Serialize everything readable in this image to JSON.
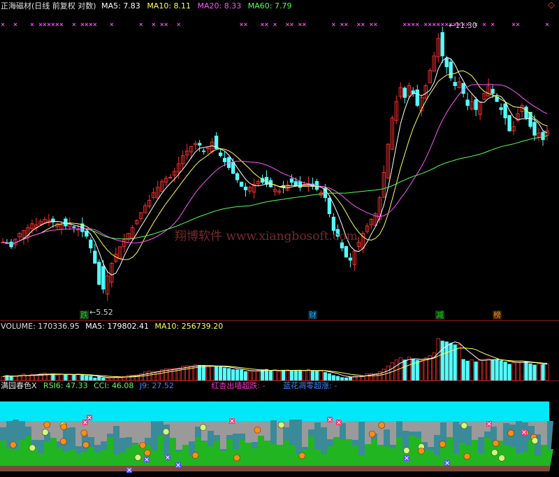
{
  "header": {
    "title": "正海磁材(日线 前复权 对数)",
    "ma5_label": "MA5:",
    "ma5_value": "7.83",
    "ma10_label": "MA10:",
    "ma10_value": "8.11",
    "ma20_label": "MA20:",
    "ma20_value": "8.33",
    "ma60_label": "MA60:",
    "ma60_value": "7.79",
    "corner_icon": "diamond-icon"
  },
  "main_chart": {
    "high_label": "11.30",
    "low_label": "5.52",
    "signals": [
      {
        "text": "跌",
        "color": "#00c000"
      },
      {
        "text": "财",
        "color": "#00c0ff"
      },
      {
        "text": "减",
        "color": "#00c000"
      },
      {
        "text": "榜",
        "color": "#ff9900"
      }
    ],
    "watermark": "翔博软件  www.xiangbosoft.com",
    "colors": {
      "up": "#ff3030",
      "down": "#54ffff",
      "ma5": "#ffffff",
      "ma10": "#ffff55",
      "ma20": "#ff55ff",
      "ma60": "#55ff55",
      "marker": "#ff44ff"
    }
  },
  "volume": {
    "label": "VOLUME:",
    "value": "170336.95",
    "ma5_label": "MA5:",
    "ma5_value": "179802.41",
    "ma10_label": "MA10:",
    "ma10_value": "256739.20"
  },
  "indicator": {
    "name": "满园春色X",
    "rsi_label": "RSI6:",
    "rsi_value": "47.33",
    "cci_label": "CCI:",
    "cci_value": "46.08",
    "j_label": "J9:",
    "j_value": "27.52",
    "red_label": "红杏出墙超跌:",
    "red_value": "-",
    "blue_label": "蓝花凋零超涨:",
    "blue_value": "-",
    "colors": {
      "sky": "#00e8f8",
      "ground": "#9a9a9a",
      "grass": "#22b522",
      "soil": "#7a4a3a"
    }
  },
  "chart_data": {
    "type": "candlestick",
    "price_scale": "log",
    "series_names": [
      "MA5",
      "MA10",
      "MA20",
      "MA60"
    ],
    "ylim": [
      5.2,
      11.6
    ],
    "closes": [
      6.3,
      6.28,
      6.22,
      6.35,
      6.45,
      6.5,
      6.55,
      6.62,
      6.6,
      6.66,
      6.7,
      6.68,
      6.65,
      6.62,
      6.6,
      6.58,
      6.62,
      6.56,
      6.52,
      6.48,
      6.4,
      6.2,
      5.95,
      5.62,
      5.55,
      5.75,
      5.95,
      6.1,
      6.22,
      6.34,
      6.45,
      6.55,
      6.68,
      6.82,
      6.95,
      7.05,
      7.2,
      7.3,
      7.42,
      7.48,
      7.5,
      7.62,
      7.78,
      7.95,
      8.05,
      8.15,
      8.22,
      8.18,
      8.05,
      8.12,
      8.25,
      8.1,
      7.95,
      7.82,
      7.7,
      7.58,
      7.45,
      7.32,
      7.25,
      7.3,
      7.36,
      7.42,
      7.4,
      7.36,
      7.31,
      7.26,
      7.23,
      7.3,
      7.35,
      7.4,
      7.33,
      7.3,
      7.36,
      7.38,
      7.32,
      7.26,
      7.2,
      7.1,
      6.8,
      6.5,
      6.4,
      6.2,
      6.05,
      6.0,
      6.15,
      6.3,
      6.45,
      6.58,
      6.7,
      6.8,
      7.1,
      7.6,
      8.2,
      8.8,
      9.2,
      9.55,
      9.3,
      9.6,
      9.4,
      9.1,
      9.3,
      9.6,
      10.0,
      10.4,
      10.9,
      10.4,
      10.1,
      9.8,
      9.6,
      9.7,
      9.4,
      9.1,
      9.2,
      9.0,
      9.2,
      9.4,
      9.6,
      9.4,
      9.2,
      9.0,
      8.8,
      8.5,
      8.6,
      8.9,
      9.1,
      8.8,
      8.6,
      8.4,
      8.45,
      8.3,
      8.5
    ]
  }
}
